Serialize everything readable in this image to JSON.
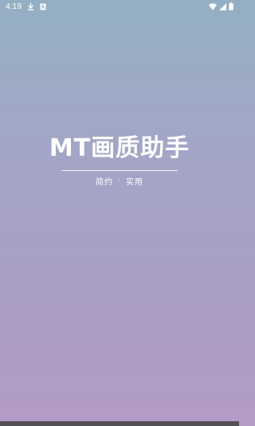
{
  "status_bar": {
    "time": "4:19",
    "icons": [
      "download-icon",
      "notification-a-icon",
      "wifi-icon",
      "signal-icon",
      "battery-icon"
    ]
  },
  "splash": {
    "title": "MT画质助手",
    "tagline_left": "简约",
    "tagline_separator": "·",
    "tagline_right": "实用"
  },
  "colors": {
    "gradient_top": "#94AFC3",
    "gradient_bottom": "#B39BC6",
    "text": "#FFFFFF",
    "nav_bar": "#555159"
  }
}
